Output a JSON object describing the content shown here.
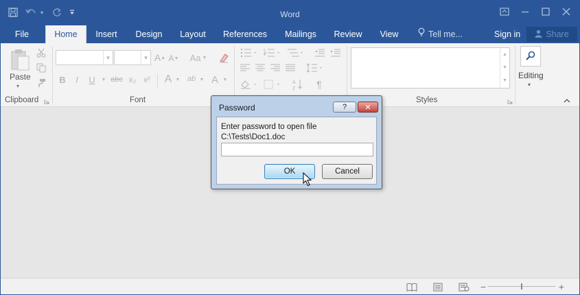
{
  "window": {
    "title": "Word",
    "controls": [
      "ribbon-display-options",
      "minimize",
      "maximize",
      "close"
    ]
  },
  "quick_access": {
    "items": [
      "save",
      "undo",
      "redo",
      "customize"
    ]
  },
  "tabs": [
    {
      "label": "File",
      "active": false
    },
    {
      "label": "Home",
      "active": true
    },
    {
      "label": "Insert",
      "active": false
    },
    {
      "label": "Design",
      "active": false
    },
    {
      "label": "Layout",
      "active": false
    },
    {
      "label": "References",
      "active": false
    },
    {
      "label": "Mailings",
      "active": false
    },
    {
      "label": "Review",
      "active": false
    },
    {
      "label": "View",
      "active": false
    }
  ],
  "tell_me": {
    "placeholder": "Tell me..."
  },
  "account": {
    "sign_in": "Sign in",
    "share": "Share"
  },
  "ribbon": {
    "clipboard": {
      "label": "Clipboard",
      "paste": "Paste"
    },
    "font": {
      "label": "Font",
      "font_name": "",
      "font_size": "",
      "grow": "A",
      "shrink": "A",
      "change_case": "Aa",
      "bold": "B",
      "italic": "I",
      "underline": "U",
      "strikethrough": "abc",
      "subscript": "x₂",
      "superscript": "x²",
      "text_effects": "A",
      "highlight": "ab",
      "font_color": "A"
    },
    "paragraph": {
      "label": "",
      "pilcrow": "¶"
    },
    "styles": {
      "label": "Styles"
    },
    "editing": {
      "label": "Editing"
    }
  },
  "dialog": {
    "title": "Password",
    "help": "?",
    "prompt": "Enter password to open file",
    "path": "C:\\Tests\\Doc1.doc",
    "password_value": "",
    "ok": "OK",
    "cancel": "Cancel"
  },
  "colors": {
    "accent": "#2b579a",
    "ribbon_bg": "#f3f3f3",
    "doc_bg": "#e6e6e6"
  }
}
